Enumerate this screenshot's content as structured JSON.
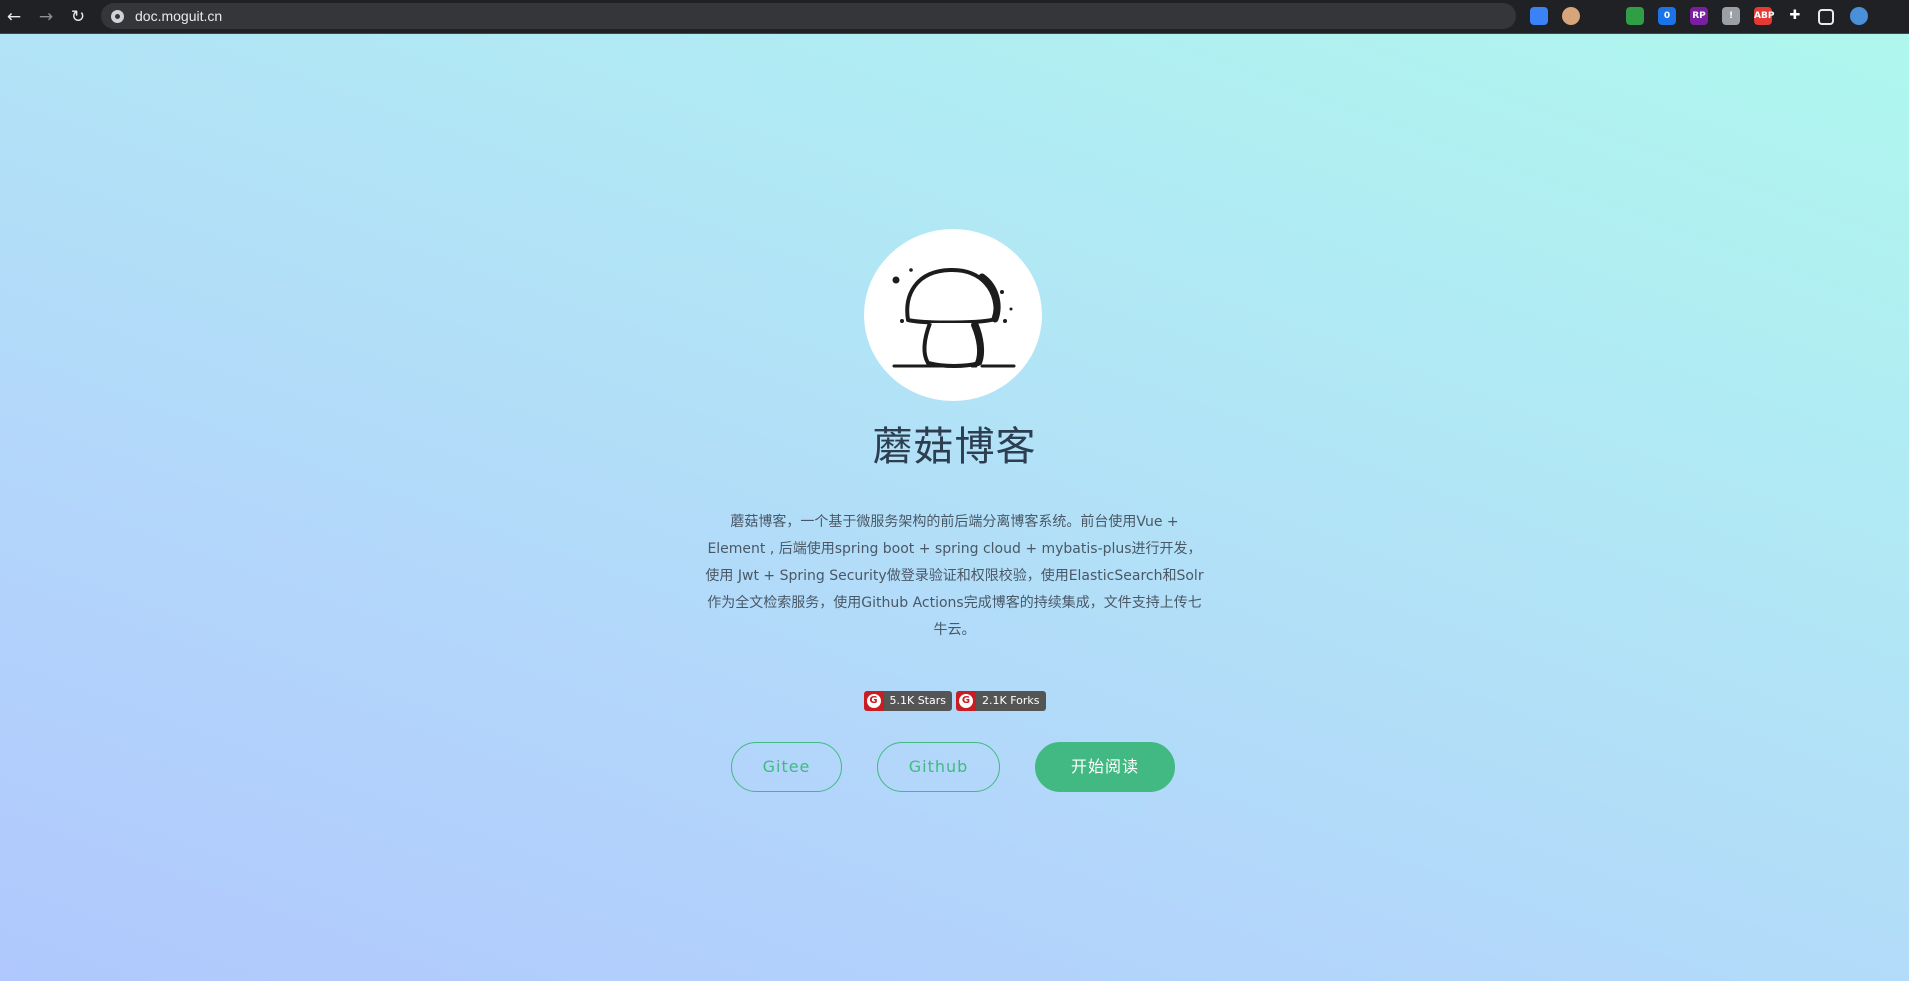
{
  "browser": {
    "url": "doc.moguit.cn",
    "nav": {
      "back": "←",
      "forward": "→",
      "reload": "↻"
    },
    "extensions": [
      {
        "name": "graduation-cap-extension",
        "label": "",
        "color": "#3b82f6"
      },
      {
        "name": "avatar-extension",
        "label": "",
        "color": "#d6a57a"
      },
      {
        "name": "vue-devtools-extension",
        "label": "",
        "color": "#202124"
      },
      {
        "name": "leaf-extension",
        "label": "",
        "color": "#2f9e44"
      },
      {
        "name": "sync-extension",
        "label": "0",
        "color": "#1a73e8"
      },
      {
        "name": "rp-extension",
        "label": "RP",
        "color": "#7b1fa2"
      },
      {
        "name": "grid-extension",
        "label": "!",
        "color": "#9aa0a6"
      },
      {
        "name": "adblock-plus-extension",
        "label": "ABP",
        "color": "#e53935"
      },
      {
        "name": "puzzle-extensions-menu",
        "label": "",
        "color": "#202124"
      },
      {
        "name": "side-panel-toggle",
        "label": "",
        "color": "#202124"
      },
      {
        "name": "profile-avatar",
        "label": "",
        "color": "#4a90d9"
      }
    ]
  },
  "hero": {
    "title": "蘑菇博客",
    "description": "蘑菇博客，一个基于微服务架构的前后端分离博客系统。前台使用Vue + Element , 后端使用spring boot + spring cloud + mybatis-plus进行开发，使用 Jwt + Spring Security做登录验证和权限校验，使用ElasticSearch和Solr作为全文检索服务，使用Github Actions完成博客的持续集成，文件支持上传七牛云。",
    "badges": [
      {
        "icon": "gitee-icon",
        "icon_glyph": "G",
        "label": "5.1K Stars"
      },
      {
        "icon": "gitee-icon",
        "icon_glyph": "G",
        "label": "2.1K Forks"
      }
    ],
    "buttons": {
      "gitee": "Gitee",
      "github": "Github",
      "start": "开始阅读"
    },
    "accent_color": "#42b983"
  }
}
